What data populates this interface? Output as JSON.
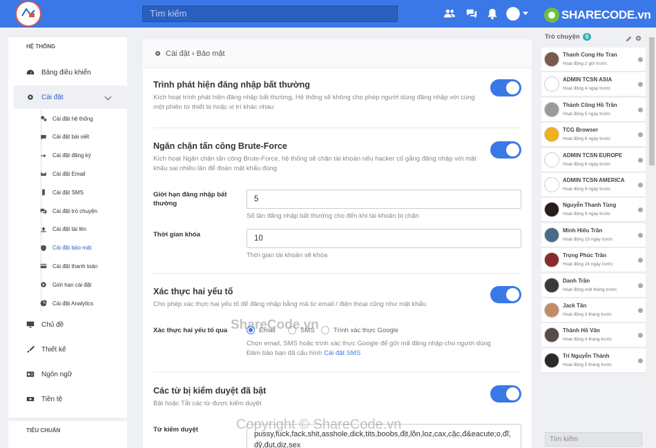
{
  "topbar": {
    "search_placeholder": "Tìm kiếm",
    "brand": "SHARECODE.vn",
    "brand_share": "SHARE",
    "brand_code": "CODE.vn"
  },
  "sidebar": {
    "section_system": "HỆ THỐNG",
    "section_standard": "TIÊU CHUẨN",
    "dashboard": "Bảng điều khiển",
    "settings": "Cài đặt",
    "sub_items": [
      {
        "label": "Cài đặt hệ thống",
        "icon": "cogs-icon"
      },
      {
        "label": "Cài đặt bài viết",
        "icon": "comment-icon"
      },
      {
        "label": "Cài đặt đăng ký",
        "icon": "sign-in-icon"
      },
      {
        "label": "Cài đặt Email",
        "icon": "envelope-icon"
      },
      {
        "label": "Cài đặt SMS",
        "icon": "mobile-icon"
      },
      {
        "label": "Cài đặt trò chuyện",
        "icon": "comments-icon"
      },
      {
        "label": "Cài đặt tải lên",
        "icon": "upload-icon"
      },
      {
        "label": "Cài đặt bảo mật",
        "icon": "shield-icon"
      },
      {
        "label": "Cài đặt thanh toán",
        "icon": "credit-card-icon"
      },
      {
        "label": "Giới hạn cài đặt",
        "icon": "sliders-icon"
      },
      {
        "label": "Cài đặt Analytics",
        "icon": "chart-pie-icon"
      }
    ],
    "theme": "Chủ đề",
    "design": "Thiết kế",
    "language": "Ngôn ngữ",
    "currency": "Tiền tệ"
  },
  "breadcrumb": "Cài đặt › Bảo mật",
  "sections": {
    "unusual_login": {
      "title": "Trình phát hiện đăng nhập bất thường",
      "desc": "Kích hoạt trình phát hiện đăng nhập bất thường, Hệ thống sẽ không cho phép người dùng đăng nhập với cùng một phiên từ thiết bị hoặc vị trí khác nhau",
      "enabled": true
    },
    "brute_force": {
      "title": "Ngăn chặn tấn công Brute-Force",
      "desc": "Kích hoạt Ngăn chặn tấn công Brute-Force, hệ thống sẽ chặn tài khoản nếu hacker cố gắng đăng nhập với mật khẩu sai nhiều lần để đoán mật khẩu đúng",
      "enabled": true,
      "limit_label": "Giới hạn đăng nhập bất thường",
      "limit_value": "5",
      "limit_hint": "Số lần đăng nhập bất thường cho đến khi tài khoản bị chặn",
      "lock_label": "Thời gian khóa",
      "lock_value": "10",
      "lock_hint": "Thời gian tài khoản sẽ khóa"
    },
    "two_factor": {
      "title": "Xác thực hai yếu tố",
      "desc": "Cho phép xác thực hai yếu tố để đăng nhập bằng mã từ email / điện thoại cũng như mật khẩu",
      "enabled": true,
      "via_label": "Xác thực hai yếu tố qua",
      "options": [
        "Email",
        "SMS",
        "Trình xác thực Google"
      ],
      "selected": "Email",
      "hint": "Chọn email, SMS hoặc trình xác thực Google để gửi mã đăng nhập cho người dùng",
      "hint2": "Đảm bảo bạn đã cấu hình",
      "hint2_link": "Cài đặt SMS"
    },
    "censored": {
      "title": "Các từ bị kiểm duyệt đã bật",
      "desc": "Bật hoặc Tắt các từ được kiểm duyệt",
      "enabled": true,
      "words_label": "Từ kiểm duyệt",
      "words_value": "pussy,fuck,fack,shit,asshole,dick,tits,boobs,địt,lồn,loz,cax,cặc,đ&eacute;o,đĩ,đỹ,đụt,diz,sex"
    }
  },
  "chat": {
    "title": "Trò chuyện",
    "count": "0",
    "search_placeholder": "Tìm kiếm",
    "users": [
      {
        "name": "Thanh Cong Ho Tran",
        "status": "Hoạt động 2 giờ trước"
      },
      {
        "name": "ADMIN TCSN ASIA",
        "status": "Hoạt động 4 ngày trước"
      },
      {
        "name": "Thành Công Hồ Trần",
        "status": "Hoạt động 5 ngày trước"
      },
      {
        "name": "TCG Browser",
        "status": "Hoạt động 6 ngày trước"
      },
      {
        "name": "ADMIN TCSN EUROPE",
        "status": "Hoạt động 6 ngày trước"
      },
      {
        "name": "ADMIN TCSN AMERICA",
        "status": "Hoạt động 9 ngày trước"
      },
      {
        "name": "Nguyễn Thanh Tùng",
        "status": "Hoạt động 9 ngày trước"
      },
      {
        "name": "Minh Hiếu Trần",
        "status": "Hoạt động 19 ngày trước"
      },
      {
        "name": "Trọng Phúc Trần",
        "status": "Hoạt động 24 ngày trước"
      },
      {
        "name": "Danh Trần",
        "status": "Hoạt động một tháng trước"
      },
      {
        "name": "Jack Tân",
        "status": "Hoạt động 3 tháng trước"
      },
      {
        "name": "Thành Hồ Văn",
        "status": "Hoạt động 4 tháng trước"
      },
      {
        "name": "Trí Nguyễn Thành",
        "status": "Hoạt động 5 tháng trước"
      }
    ]
  },
  "watermarks": {
    "center": "ShareCode.vn",
    "bottom": "Copyright © ShareCode.vn"
  },
  "colors": {
    "accent": "#3b78e7",
    "brand_green": "#6fbf3b",
    "badge": "#2db3b3"
  }
}
